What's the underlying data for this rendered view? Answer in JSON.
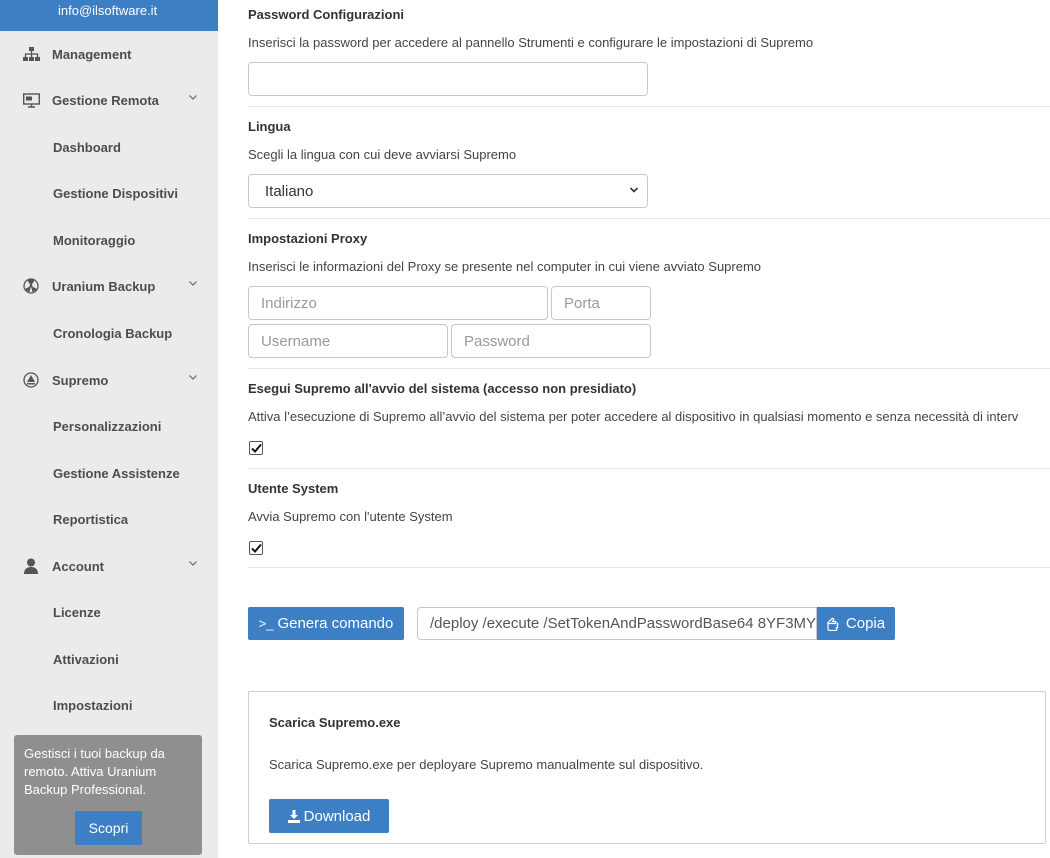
{
  "sidebar": {
    "user_email": "info@ilsoftware.it",
    "items": [
      {
        "label": "Management",
        "icon": "sitemap-icon"
      },
      {
        "label": "Gestione Remota",
        "icon": "monitor-icon"
      },
      {
        "label": "Dashboard"
      },
      {
        "label": "Gestione Dispositivi"
      },
      {
        "label": "Monitoraggio"
      },
      {
        "label": "Uranium Backup",
        "icon": "radiation-icon"
      },
      {
        "label": "Cronologia Backup"
      },
      {
        "label": "Supremo",
        "icon": "supremo-icon"
      },
      {
        "label": "Personalizzazioni"
      },
      {
        "label": "Gestione Assistenze"
      },
      {
        "label": "Reportistica"
      },
      {
        "label": "Account",
        "icon": "user-icon"
      },
      {
        "label": "Licenze"
      },
      {
        "label": "Attivazioni"
      },
      {
        "label": "Impostazioni"
      }
    ],
    "promo": {
      "text": "Gestisci i tuoi backup da remoto. Attiva Uranium Backup Professional.",
      "button": "Scopri"
    }
  },
  "main": {
    "password_section": {
      "title": "Password Configurazioni",
      "description": "Inserisci la password per accedere al pannello Strumenti e configurare le impostazioni di Supremo",
      "value": ""
    },
    "language_section": {
      "title": "Lingua",
      "description": "Scegli la lingua con cui deve avviarsi Supremo",
      "selected": "Italiano"
    },
    "proxy_section": {
      "title": "Impostazioni Proxy",
      "description": "Inserisci le informazioni del Proxy se presente nel computer in cui viene avviato Supremo",
      "address_placeholder": "Indirizzo",
      "port_placeholder": "Porta",
      "username_placeholder": "Username",
      "password_placeholder": "Password"
    },
    "autostart_section": {
      "title": "Esegui Supremo all'avvio del sistema (accesso non presidiato)",
      "description": "Attiva l’esecuzione di Supremo all’avvio del sistema per poter accedere al dispositivo in qualsiasi momento e senza necessità di interv",
      "checked": true
    },
    "system_user_section": {
      "title": "Utente System",
      "description": "Avvia Supremo con l'utente System",
      "checked": true
    },
    "command": {
      "generate_label": "Genera comando",
      "generate_prefix": ">_",
      "value": "/deploy /execute /SetTokenAndPasswordBase64 8YF3MY\\",
      "copy_label": "Copia"
    },
    "download_panel": {
      "title": "Scarica Supremo.exe",
      "description": "Scarica Supremo.exe per deployare Supremo manualmente sul dispositivo.",
      "button_label": "Download"
    }
  },
  "colors": {
    "accent": "#3c7fc4",
    "sidebar_bg": "#ebebeb",
    "promo_bg": "#8f8f8f"
  }
}
